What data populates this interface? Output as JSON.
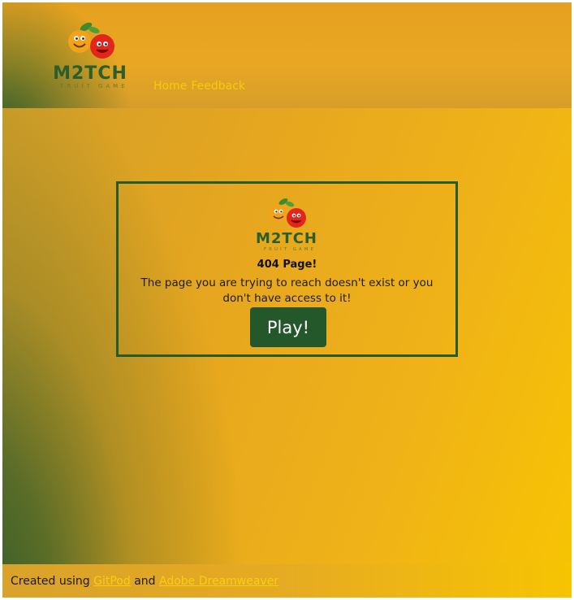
{
  "header": {
    "logo_text": "M2TCH",
    "logo_subtext": "FRUIT GAME",
    "nav": [
      "Home",
      "Feedback"
    ]
  },
  "card": {
    "logo_text": "M2TCH",
    "logo_subtext": "FRUIT GAME",
    "title": "404 Page!",
    "message": "The page you are trying to reach doesn't exist or you don't have access to it!",
    "button_label": "Play!"
  },
  "footer": {
    "prefix": "Created using",
    "link1": "GitPod",
    "middle": "and",
    "link2": "Adobe Dreamweaver"
  },
  "colors": {
    "brand_green": "#24572a",
    "nav_yellow": "#f7c90e",
    "background_yellow": "#f7c402",
    "background_green": "#2d5a2a",
    "fruit_orange": "#f2a31b",
    "fruit_red": "#e2261c"
  }
}
